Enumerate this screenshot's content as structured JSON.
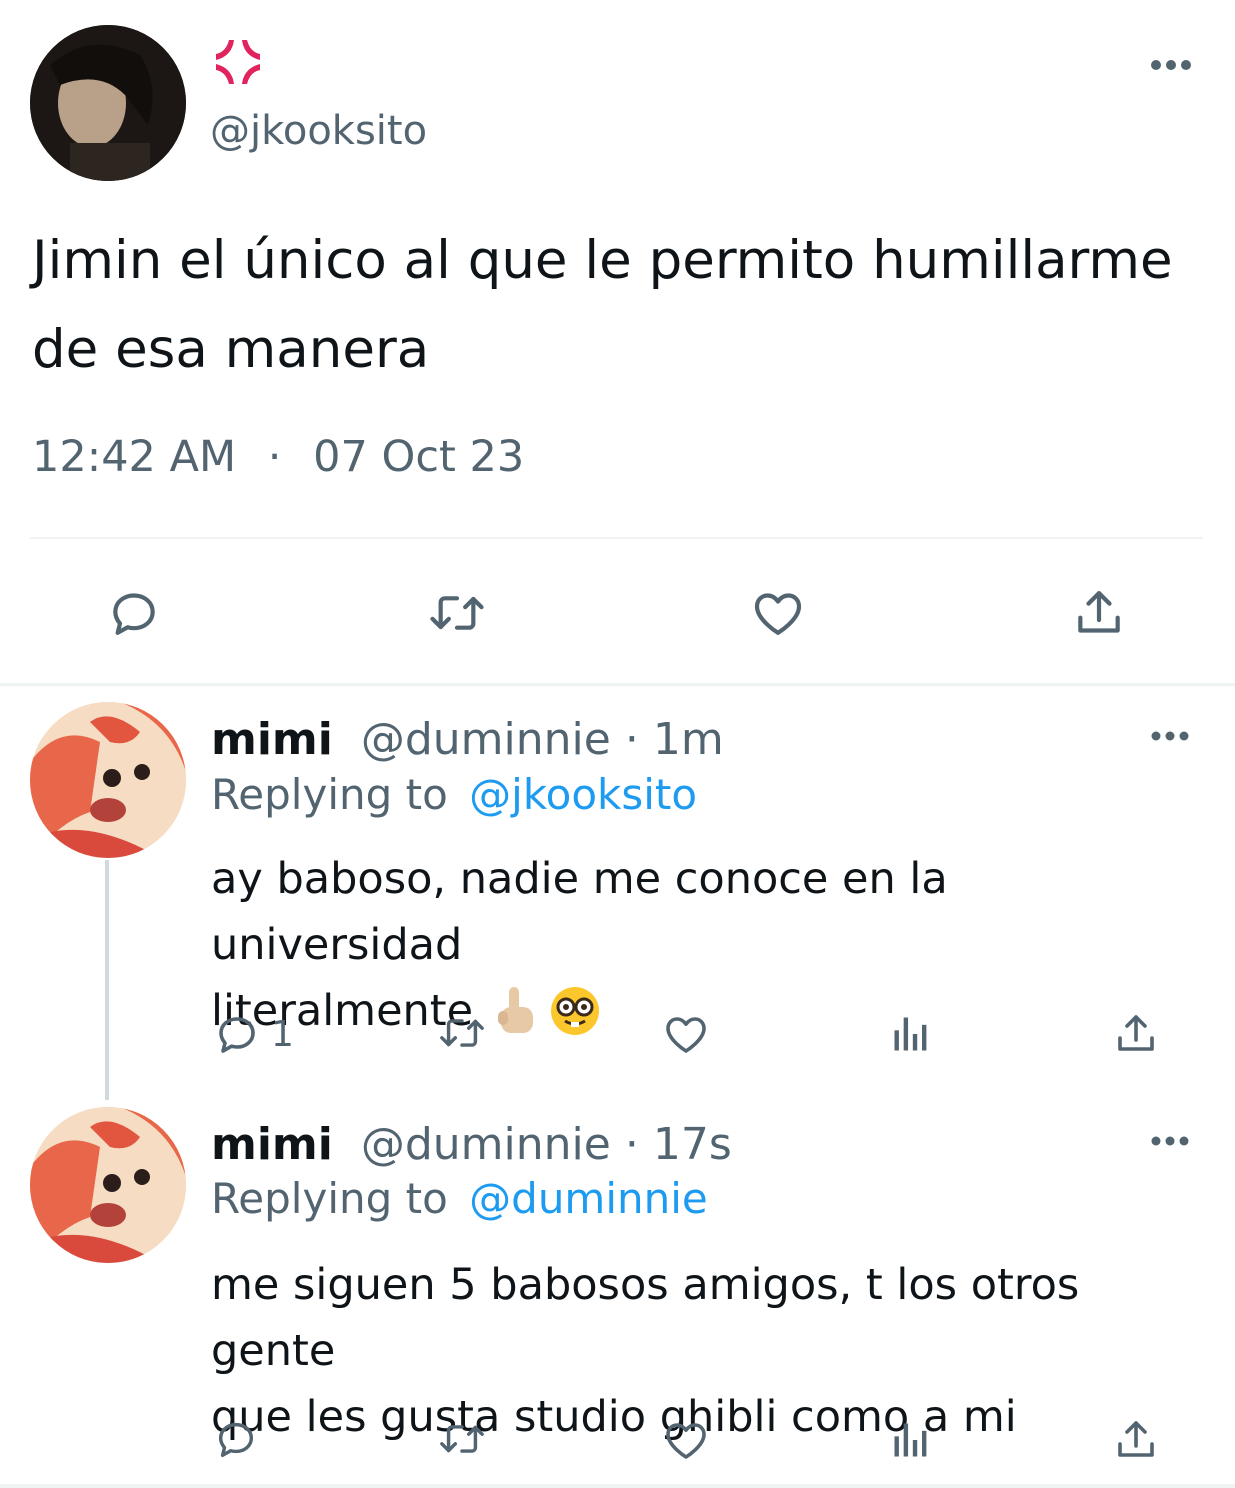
{
  "main_tweet": {
    "emoji_name": "anger-symbol-emoji",
    "handle": "@jkooksito",
    "text_line1": "Jimin el único al que le permito humillarme",
    "text_line2": "de esa manera",
    "time": "12:42 AM",
    "dot": "·",
    "date": "07 Oct 23",
    "actions": [
      "reply-icon",
      "retweet-icon",
      "like-icon",
      "share-icon"
    ]
  },
  "replies": [
    {
      "name": "mimi",
      "handle": "@duminnie",
      "sep": "·",
      "age": "1m",
      "replying_label": "Replying to",
      "replying_handle": "@jkooksito",
      "text_line1": "ay baboso, nadie me conoce en la universidad",
      "text_line2": "literalmente",
      "emojis": [
        "index-pointing-up-emoji",
        "nerd-face-emoji"
      ],
      "reply_count": "1"
    },
    {
      "name": "mimi",
      "handle": "@duminnie",
      "sep": "·",
      "age": "17s",
      "replying_label": "Replying to",
      "replying_handle": "@duminnie",
      "text_line1": "me siguen 5 babosos amigos, t los otros gente",
      "text_line2": "que les gusta studio ghibli como a mi",
      "reply_count": ""
    }
  ],
  "colors": {
    "text": "#0f1419",
    "muted": "#536471",
    "link": "#1d9bf0",
    "divider": "#eff3f4",
    "anger": "#e0245e"
  }
}
